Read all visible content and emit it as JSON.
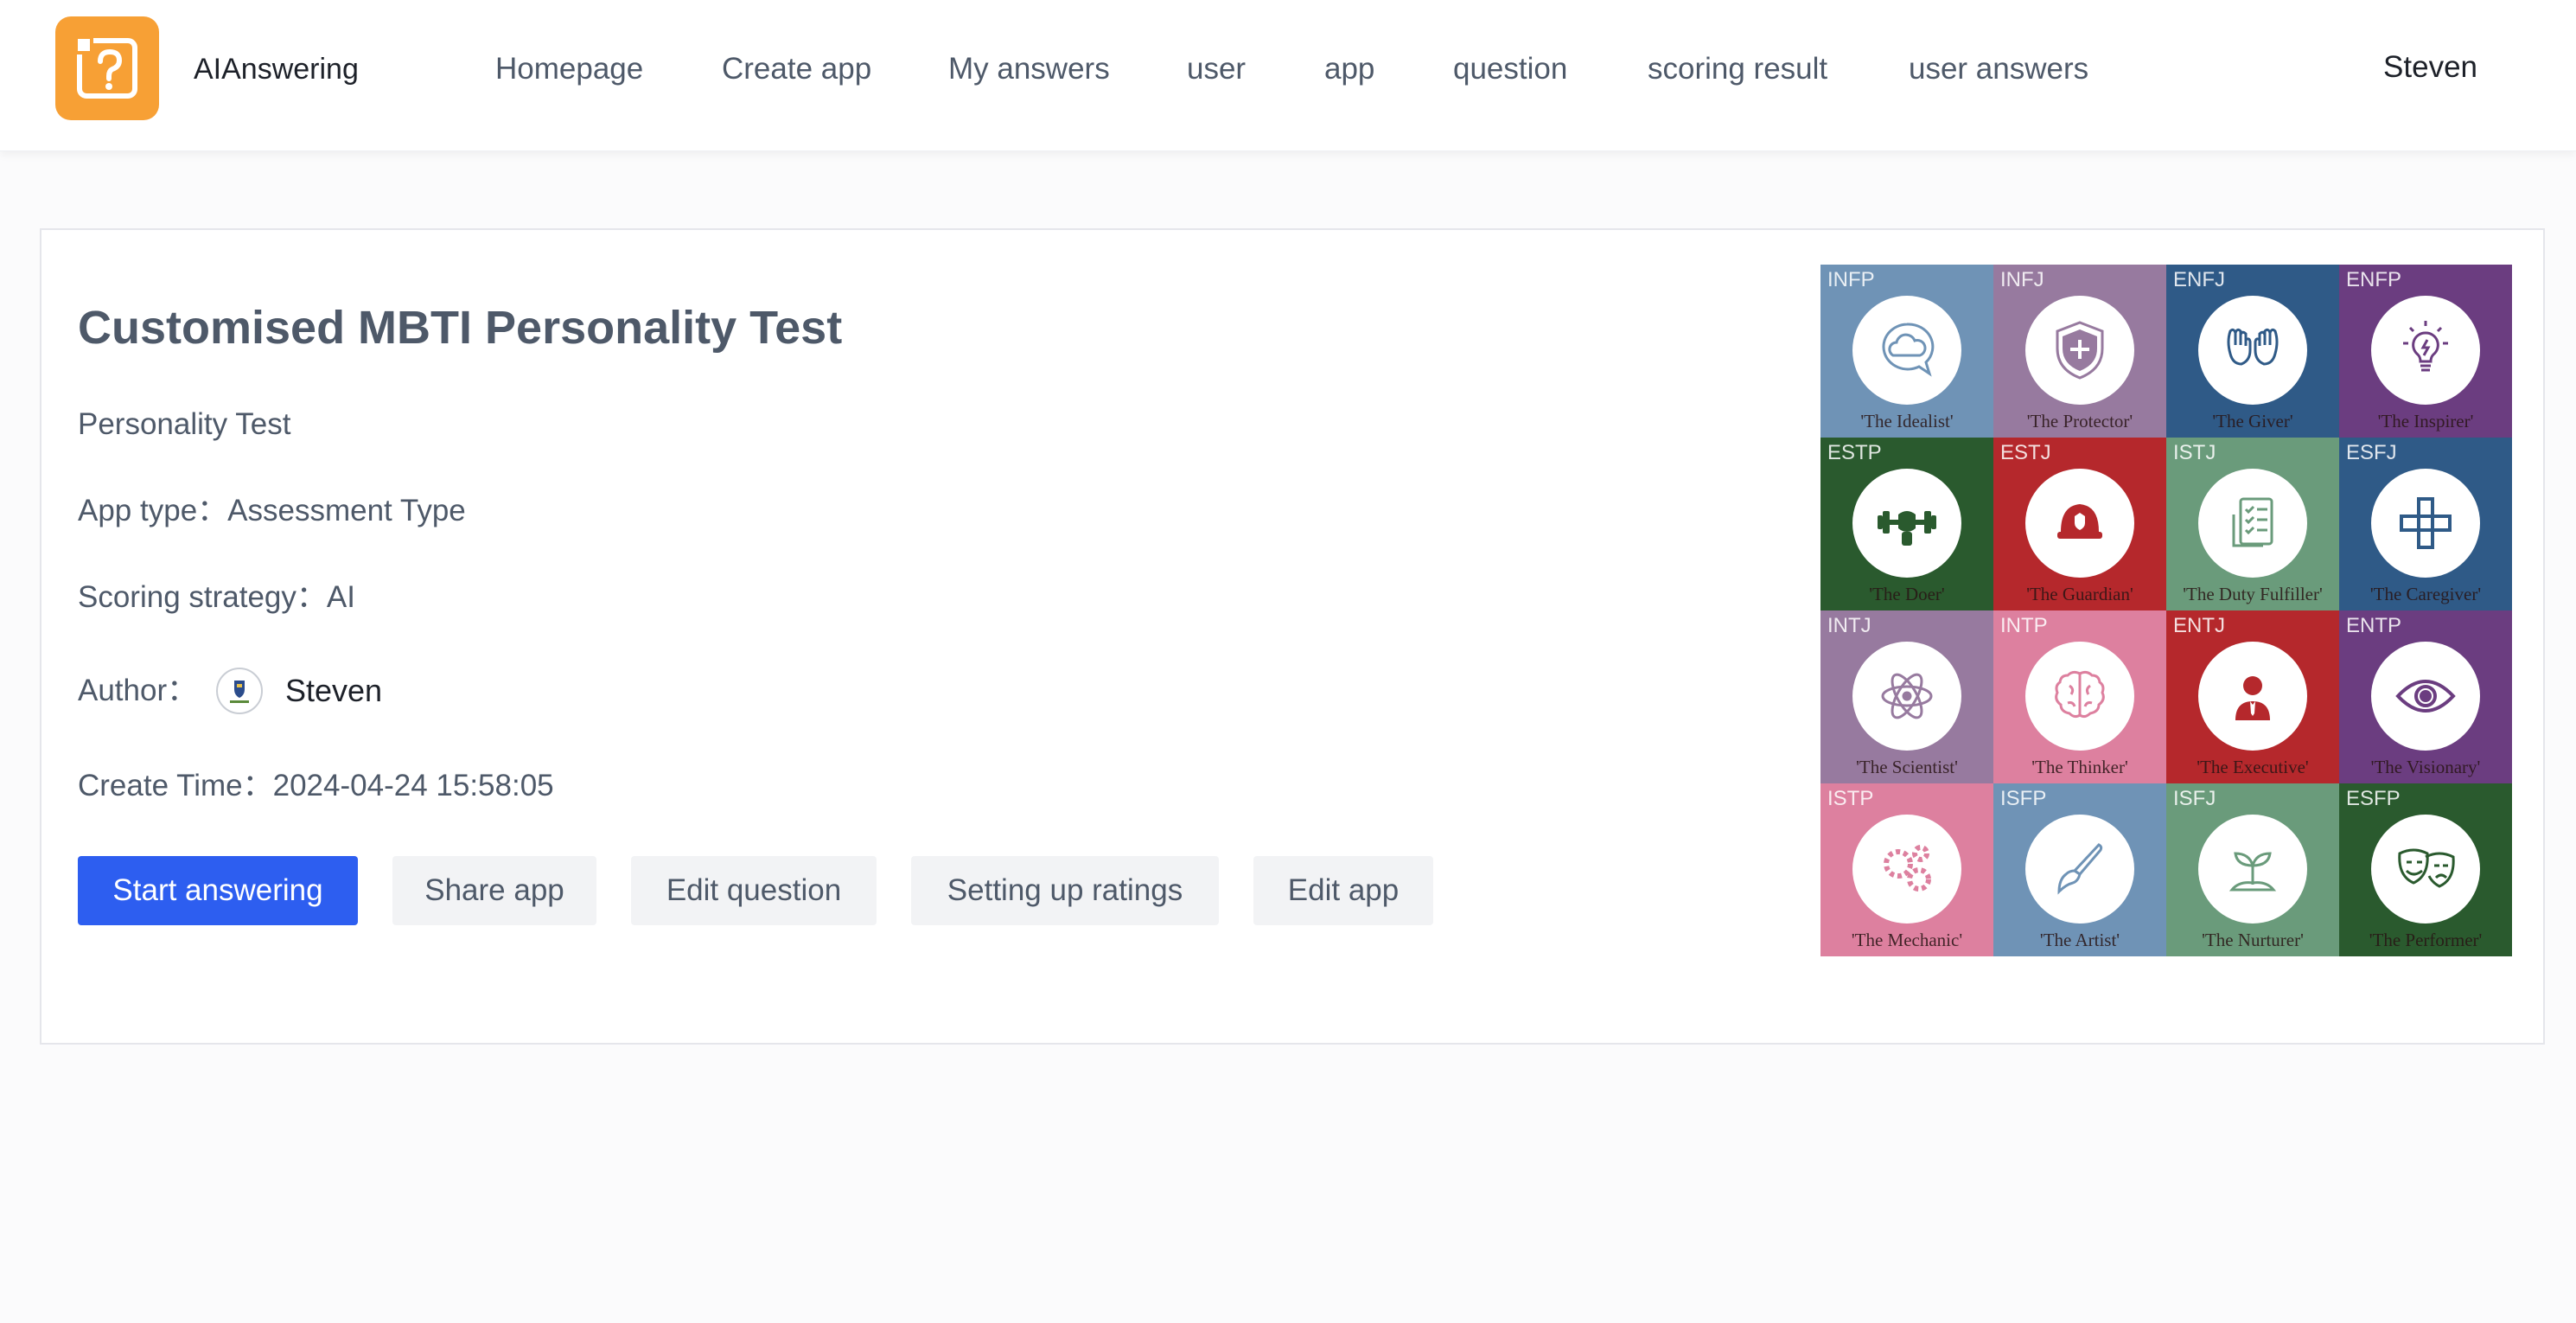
{
  "header": {
    "brand": "AIAnswering",
    "logo_icon": "question-box-icon",
    "nav": [
      {
        "label": "Homepage"
      },
      {
        "label": "Create app"
      },
      {
        "label": "My answers"
      },
      {
        "label": "user"
      },
      {
        "label": "app"
      },
      {
        "label": "question"
      },
      {
        "label": "scoring result"
      },
      {
        "label": "user answers"
      }
    ],
    "user": "Steven"
  },
  "app": {
    "title": "Customised MBTI Personality Test",
    "description": "Personality Test",
    "app_type_label": "App type：",
    "app_type": "Assessment Type",
    "scoring_label": "Scoring strategy：",
    "scoring": "AI",
    "author_label": "Author：",
    "author": "Steven",
    "create_time_label": "Create Time：",
    "create_time": "2024-04-24 15:58:05"
  },
  "actions": {
    "start": "Start answering",
    "share": "Share app",
    "edit_question": "Edit question",
    "ratings": "Setting up ratings",
    "edit_app": "Edit app"
  },
  "colors": {
    "primary": "#2d5ef0",
    "logo": "#f7a035"
  },
  "mbti_grid": [
    {
      "code": "INFP",
      "name": "'The Idealist'",
      "bg": "#6f93b6",
      "icon": "cloud-speech-icon"
    },
    {
      "code": "INFJ",
      "name": "'The Protector'",
      "bg": "#977a9f",
      "icon": "shield-icon"
    },
    {
      "code": "ENFJ",
      "name": "'The Giver'",
      "bg": "#2f5a87",
      "icon": "open-hands-icon"
    },
    {
      "code": "ENFP",
      "name": "'The Inspirer'",
      "bg": "#6b3d80",
      "icon": "lightbulb-icon"
    },
    {
      "code": "ESTP",
      "name": "'The Doer'",
      "bg": "#2a5a2e",
      "icon": "dumbbell-icon"
    },
    {
      "code": "ESTJ",
      "name": "'The Guardian'",
      "bg": "#b5282c",
      "icon": "helmet-icon"
    },
    {
      "code": "ISTJ",
      "name": "'The Duty Fulfiller'",
      "bg": "#6a9b7b",
      "icon": "checklist-icon"
    },
    {
      "code": "ESFJ",
      "name": "'The Caregiver'",
      "bg": "#2f5a87",
      "icon": "bandage-icon"
    },
    {
      "code": "INTJ",
      "name": "'The Scientist'",
      "bg": "#977a9f",
      "icon": "atom-icon"
    },
    {
      "code": "INTP",
      "name": "'The Thinker'",
      "bg": "#dd809f",
      "icon": "brain-icon"
    },
    {
      "code": "ENTJ",
      "name": "'The Executive'",
      "bg": "#b5282c",
      "icon": "executive-icon"
    },
    {
      "code": "ENTP",
      "name": "'The Visionary'",
      "bg": "#6b3d80",
      "icon": "eye-icon"
    },
    {
      "code": "ISTP",
      "name": "'The Mechanic'",
      "bg": "#dd809f",
      "icon": "gears-icon"
    },
    {
      "code": "ISFP",
      "name": "'The Artist'",
      "bg": "#6f93b6",
      "icon": "paintbrush-icon"
    },
    {
      "code": "ISFJ",
      "name": "'The Nurturer'",
      "bg": "#6a9b7b",
      "icon": "sprout-icon"
    },
    {
      "code": "ESFP",
      "name": "'The Performer'",
      "bg": "#2a5a2e",
      "icon": "theater-masks-icon"
    }
  ]
}
